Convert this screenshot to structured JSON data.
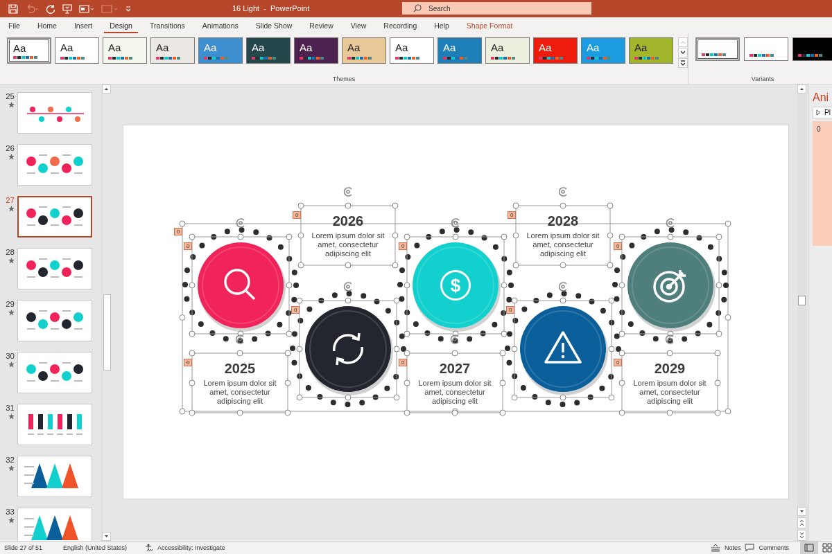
{
  "window": {
    "title": "16 Light  -  PowerPoint"
  },
  "search": {
    "placeholder": "Search"
  },
  "tabs": [
    {
      "label": "File",
      "selected": false
    },
    {
      "label": "Home",
      "selected": false
    },
    {
      "label": "Insert",
      "selected": false
    },
    {
      "label": "Design",
      "selected": true
    },
    {
      "label": "Transitions",
      "selected": false
    },
    {
      "label": "Animations",
      "selected": false
    },
    {
      "label": "Slide Show",
      "selected": false
    },
    {
      "label": "Review",
      "selected": false
    },
    {
      "label": "View",
      "selected": false
    },
    {
      "label": "Recording",
      "selected": false
    },
    {
      "label": "Help",
      "selected": false
    },
    {
      "label": "Shape Format",
      "selected": false,
      "kind": "contextual"
    }
  ],
  "themes": {
    "label": "Themes",
    "items": [
      {
        "text": "Aa",
        "color": "#ffffff",
        "selected": true
      },
      {
        "text": "Aa",
        "color": "#ffffff",
        "selected": false
      },
      {
        "text": "Aa",
        "color": "#f4f8ec",
        "selected": false
      },
      {
        "text": "Aa",
        "color": "#ece8e4",
        "selected": false
      },
      {
        "text": "Aa",
        "color": "#3d8fd0",
        "selected": false
      },
      {
        "text": "Aa",
        "color": "#24474c",
        "selected": false
      },
      {
        "text": "Aa",
        "color": "#4d2250",
        "selected": false
      },
      {
        "text": "Aa",
        "color": "#e9c898",
        "selected": false
      },
      {
        "text": "Aa",
        "color": "#ffffff",
        "selected": false
      },
      {
        "text": "Aa",
        "color": "#1e7fb8",
        "selected": false
      },
      {
        "text": "Aa",
        "color": "#eef0df",
        "selected": false
      },
      {
        "text": "Aa",
        "color": "#ee1c0c",
        "selected": false
      },
      {
        "text": "Aa",
        "color": "#1b9ce2",
        "selected": false
      },
      {
        "text": "Aa",
        "color": "#a3b52b",
        "selected": false
      }
    ]
  },
  "variants": {
    "label": "Variants",
    "items": [
      {
        "color": "#ffffff",
        "selected": true
      },
      {
        "color": "#ffffff",
        "selected": false
      },
      {
        "color": "#000000",
        "selected": false
      }
    ]
  },
  "slides": [
    {
      "number": "25",
      "selected": false
    },
    {
      "number": "26",
      "selected": false
    },
    {
      "number": "27",
      "selected": true
    },
    {
      "number": "28",
      "selected": false
    },
    {
      "number": "29",
      "selected": false
    },
    {
      "number": "30",
      "selected": false
    },
    {
      "number": "31",
      "selected": false
    },
    {
      "number": "32",
      "selected": false
    },
    {
      "number": "33",
      "selected": false
    }
  ],
  "slide": {
    "group_tag": "0",
    "items": [
      {
        "year": "2025",
        "text": "Lorem ipsum dolor sit amet, consectetur adipiscing elit",
        "color": "#f0245a",
        "kind": "search",
        "circle_tag": "0",
        "text_tag": "0"
      },
      {
        "year": "2026",
        "text": "Lorem ipsum dolor sit amet, consectetur adipiscing elit",
        "color": "#23262e",
        "kind": "refresh",
        "circle_tag": "0",
        "text_tag": "0"
      },
      {
        "year": "2027",
        "text": "Lorem ipsum dolor sit amet, consectetur adipiscing elit",
        "color": "#12d0ce",
        "kind": "dollar",
        "symbol": "$",
        "circle_tag": "0",
        "text_tag": "0"
      },
      {
        "year": "2028",
        "text": "Lorem ipsum dolor sit amet, consectetur adipiscing elit",
        "color": "#0a5f9b",
        "kind": "warning",
        "circle_tag": "0",
        "text_tag": "0"
      },
      {
        "year": "2029",
        "text": "Lorem ipsum dolor sit amet, consectetur adipiscing elit",
        "color": "#4f7f7c",
        "kind": "target",
        "circle_tag": "0",
        "text_tag": "0"
      }
    ]
  },
  "animation_pane": {
    "title": "Ani",
    "play_button": "Pl",
    "entries": [
      "0"
    ]
  },
  "status_bar": {
    "slide": "Slide 27 of 51",
    "language": "English (United States)",
    "accessibility": "Accessibility: Investigate",
    "notes": "Notes",
    "comments": "Comments"
  }
}
